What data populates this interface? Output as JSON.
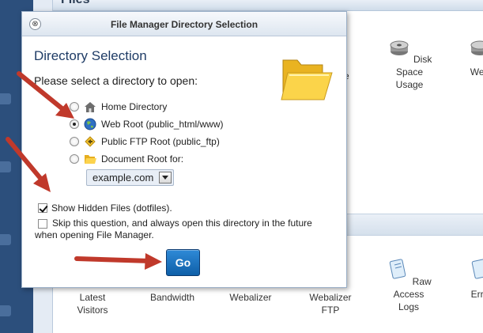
{
  "background": {
    "header_title": "Files",
    "apps_top": [
      {
        "label": "e"
      },
      {
        "label": "Disk Space Usage"
      },
      {
        "label": "Web"
      }
    ],
    "apps_bottom": [
      {
        "label": "Latest Visitors"
      },
      {
        "label": "Bandwidth"
      },
      {
        "label": "Webalizer"
      },
      {
        "label": "Webalizer FTP"
      },
      {
        "label": "Raw Access Logs"
      },
      {
        "label": "Erro"
      }
    ]
  },
  "dialog": {
    "title": "File Manager Directory Selection",
    "close_glyph": "⊗",
    "heading": "Directory Selection",
    "prompt": "Please select a directory to open:",
    "options": [
      {
        "label": "Home Directory",
        "icon": "home-icon",
        "selected": false
      },
      {
        "label": "Web Root (public_html/www)",
        "icon": "globe-icon",
        "selected": true
      },
      {
        "label": "Public FTP Root (public_ftp)",
        "icon": "ftp-icon",
        "selected": false
      },
      {
        "label": "Document Root for:",
        "icon": "folder-icon",
        "selected": false
      }
    ],
    "domain_select": {
      "value": "example.com"
    },
    "show_hidden": {
      "label": "Show Hidden Files (dotfiles).",
      "checked": true
    },
    "skip_question": {
      "label": "Skip this question, and always open this directory in the future when opening File Manager.",
      "checked": false
    },
    "go_label": "Go"
  },
  "colors": {
    "arrow": "#c0392b",
    "go_button": "#1565b0",
    "heading": "#1f3c66"
  }
}
